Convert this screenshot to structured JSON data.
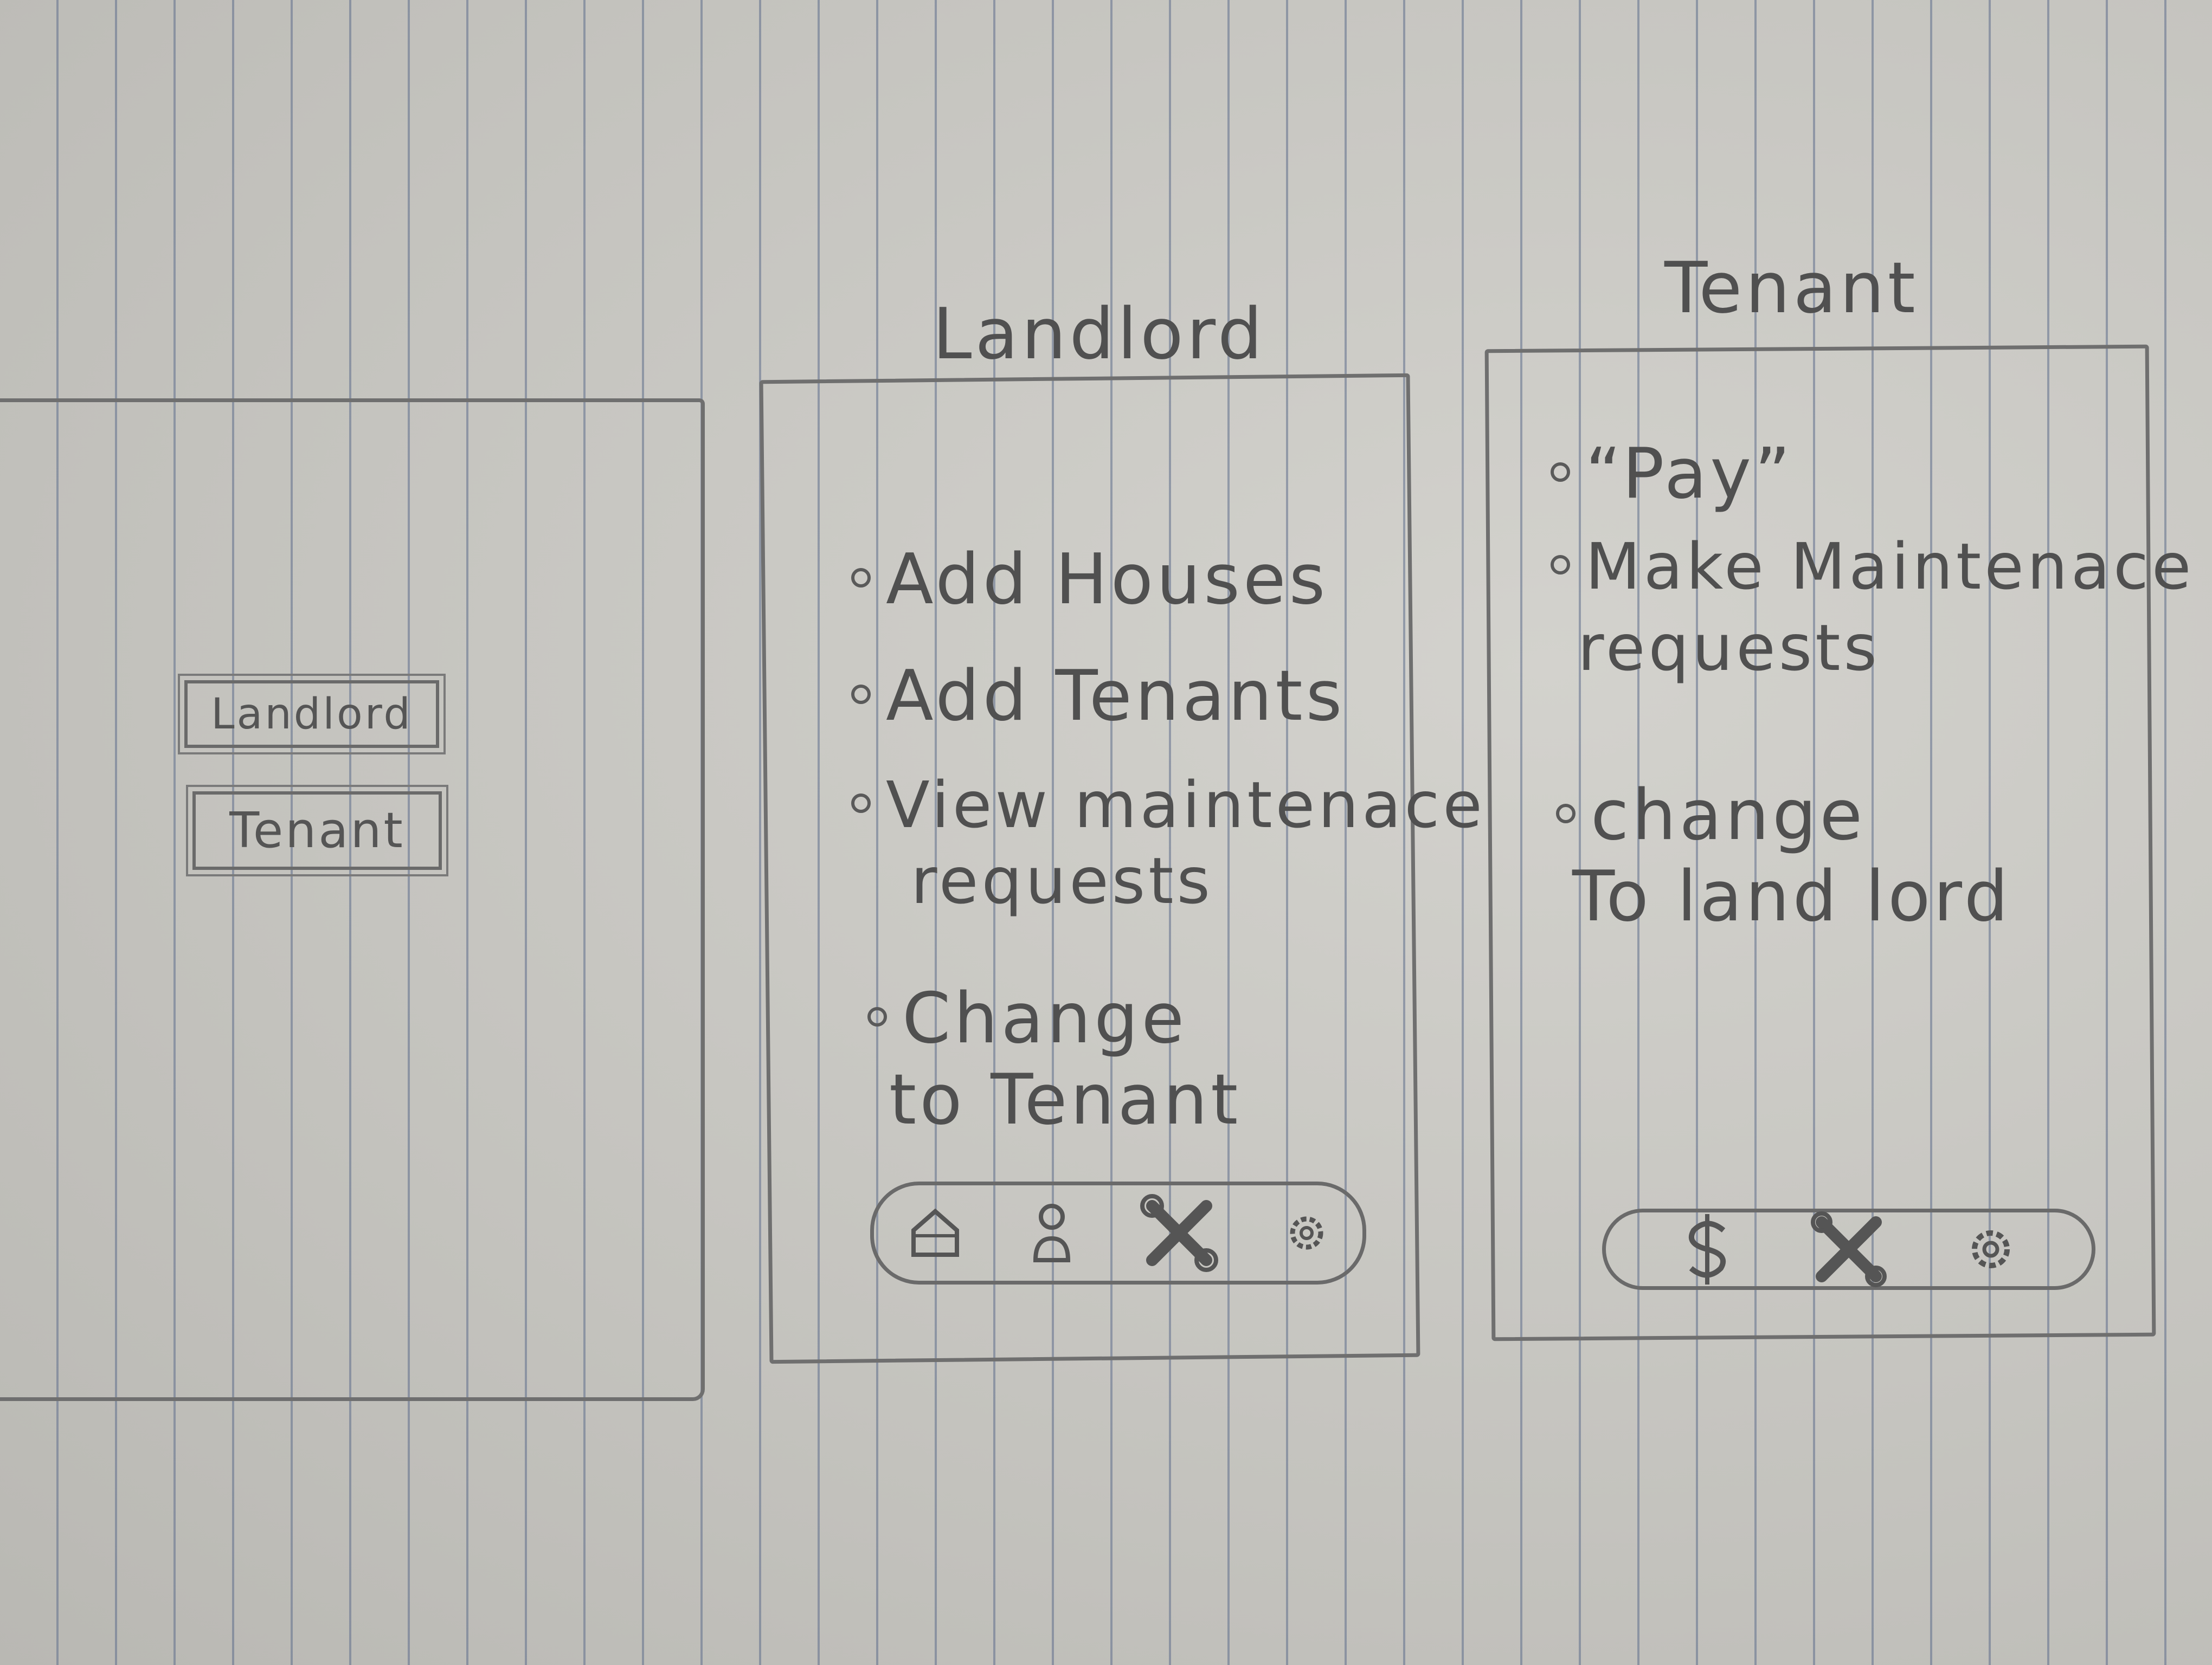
{
  "screens": {
    "login": {
      "buttons": {
        "landlord_label": "Landlord",
        "tenant_label": "Tenant"
      }
    },
    "landlord": {
      "title": "Landlord",
      "items": [
        {
          "lines": [
            "Add Houses"
          ]
        },
        {
          "lines": [
            "Add Tenants"
          ]
        },
        {
          "lines": [
            "View maintenace",
            "requests"
          ]
        },
        {
          "lines": [
            "Change",
            "to Tenant"
          ]
        }
      ],
      "nav": [
        "home-icon",
        "profile-icon",
        "tools-icon",
        "settings-icon"
      ]
    },
    "tenant": {
      "title": "Tenant",
      "items": [
        {
          "lines": [
            "“Pay”"
          ]
        },
        {
          "lines": [
            "Make Maintenace",
            "requests"
          ]
        },
        {
          "lines": [
            "change",
            "To land lord"
          ]
        }
      ],
      "nav": [
        "dollar-icon",
        "tools-icon",
        "settings-icon"
      ]
    }
  },
  "colors": {
    "paper": "#c9c8c3",
    "rule_line": "#5f6e8c",
    "pencil": "#505050"
  }
}
